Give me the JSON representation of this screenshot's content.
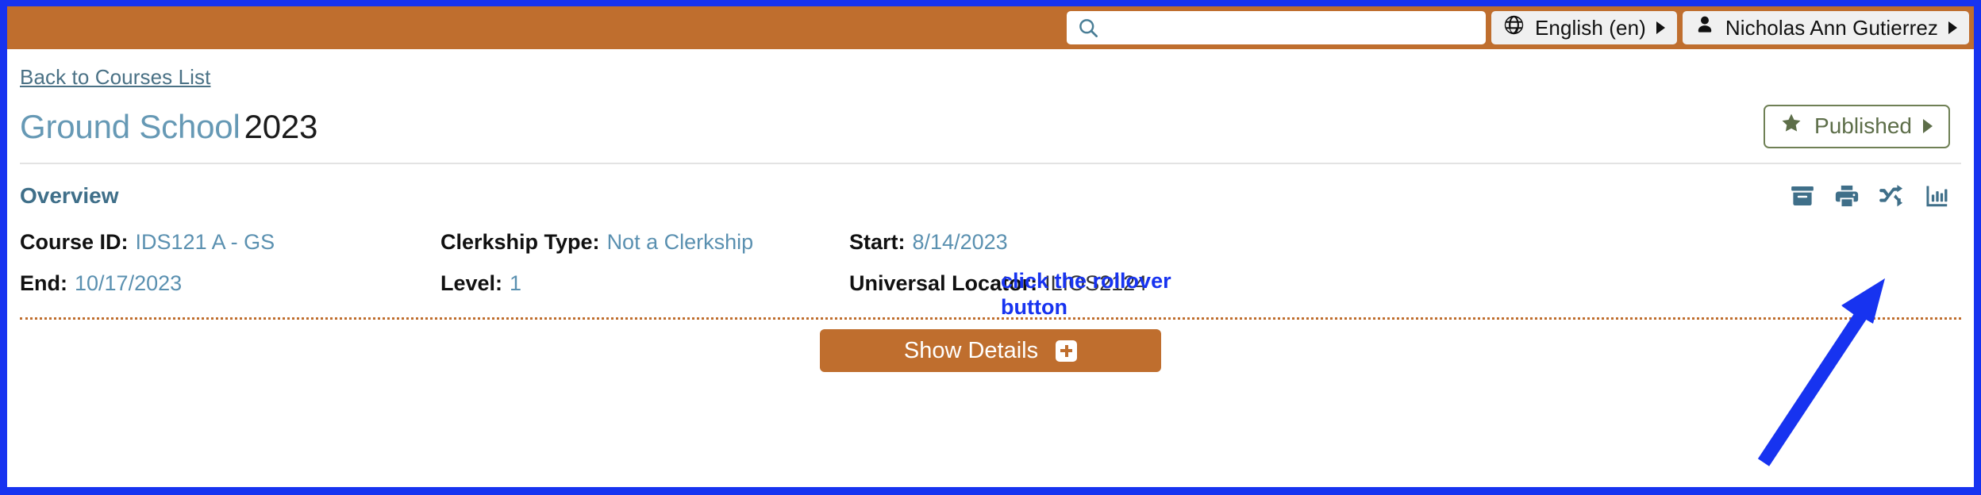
{
  "header": {
    "search": {
      "value": "",
      "placeholder": "",
      "icon": "search-icon"
    },
    "language": {
      "label": "English (en)",
      "icon": "globe-icon",
      "caret": "caret-right-icon"
    },
    "user": {
      "label": "Nicholas Ann Gutierrez",
      "icon": "user-icon",
      "caret": "caret-right-icon"
    }
  },
  "breadcrumb": {
    "back_label": "Back to Courses List"
  },
  "course": {
    "name": "Ground School",
    "year": "2023",
    "status": {
      "label": "Published",
      "icon": "star-icon",
      "caret": "caret-right-icon"
    }
  },
  "overview": {
    "title": "Overview",
    "actions": [
      {
        "name": "archive-icon",
        "title": "Archive"
      },
      {
        "name": "print-icon",
        "title": "Print"
      },
      {
        "name": "rollover-shuffle-icon",
        "title": "Rollover"
      },
      {
        "name": "bar-chart-icon",
        "title": "Reports"
      }
    ],
    "fields": [
      {
        "key": "Course ID:",
        "value": "IDS121 A - GS",
        "style": "link"
      },
      {
        "key": "Clerkship Type:",
        "value": "Not a Clerkship",
        "style": "link"
      },
      {
        "key": "Start:",
        "value": "8/14/2023",
        "style": "link"
      },
      {
        "key": "End:",
        "value": "10/17/2023",
        "style": "link"
      },
      {
        "key": "Level:",
        "value": "1",
        "style": "link"
      },
      {
        "key": "Universal Locator:",
        "value": "ILIOS2124",
        "style": "plain"
      }
    ],
    "show_details": {
      "label": "Show Details",
      "icon": "plus-icon"
    }
  },
  "annotation": {
    "text": "click the rollover button",
    "color": "#1733f0"
  },
  "colors": {
    "header_orange": "#bf6e2e",
    "accent_blue": "#3f6f89",
    "title_blue": "#6699b5",
    "link_blue": "#5a90b0",
    "published_green": "#5d6e49",
    "annotation_blue": "#1733f0"
  }
}
